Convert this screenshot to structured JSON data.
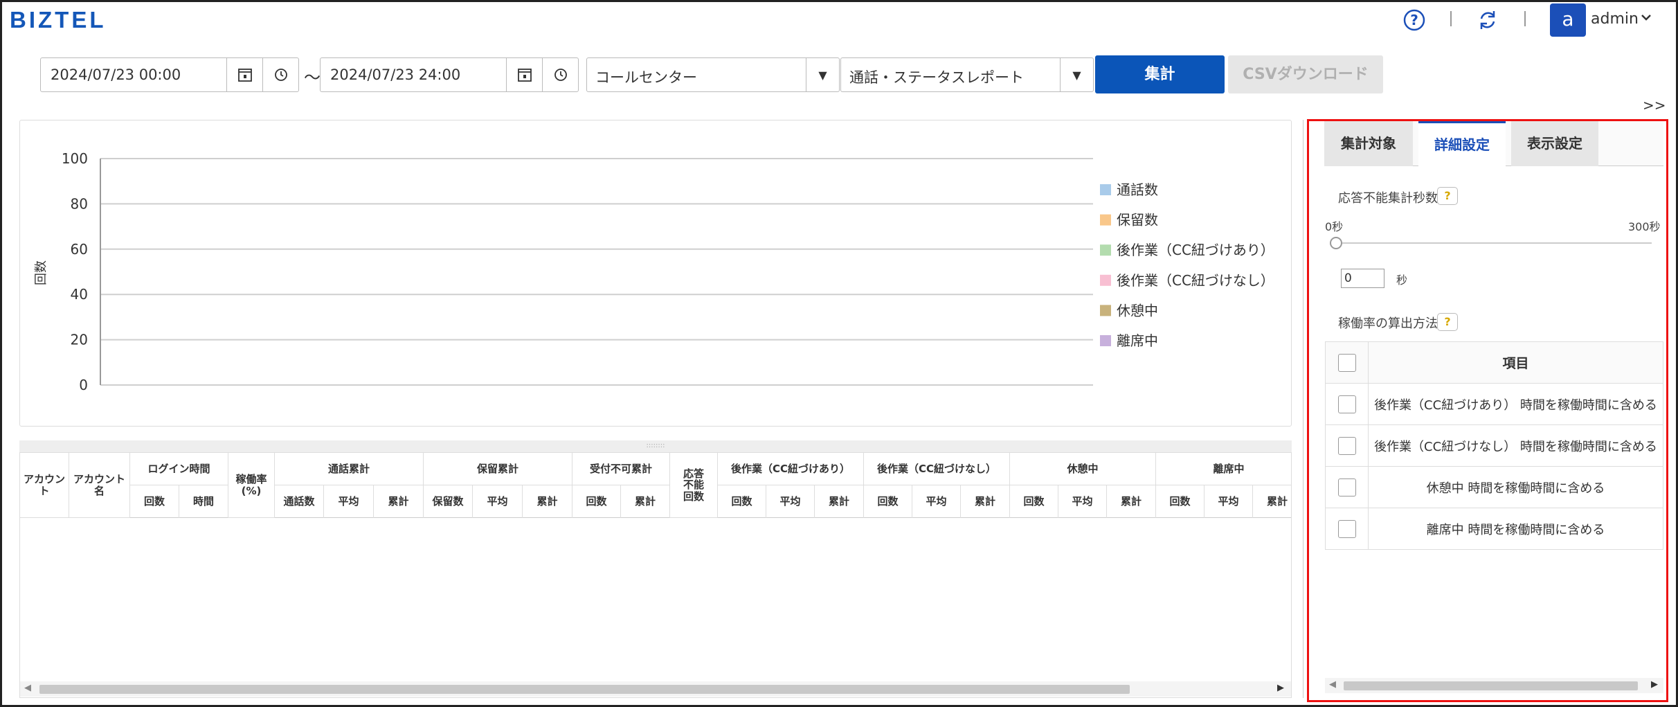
{
  "header": {
    "logo": "BIZTEL",
    "avatar_letter": "a",
    "user_name": "admin",
    "icons": [
      "help-icon",
      "refresh-icon",
      "chevron-down-icon"
    ]
  },
  "toolbar": {
    "start_datetime": "2024/07/23 00:00",
    "end_datetime": "2024/07/23 24:00",
    "range_separator": "～",
    "group_select": "コールセンター",
    "report_select": "通話・ステータスレポート",
    "aggregate_label": "集計",
    "csv_label": "CSVダウンロード",
    "expand_label": ">>"
  },
  "chart_data": {
    "type": "bar",
    "ylabel": "回数",
    "ylim": [
      0,
      100
    ],
    "yticks": [
      "0",
      "20",
      "40",
      "60",
      "80",
      "100"
    ],
    "grid": true,
    "legend_position": "right",
    "series": [
      {
        "name": "通話数",
        "color": "#a9cbea",
        "values": []
      },
      {
        "name": "保留数",
        "color": "#f9c78a",
        "values": []
      },
      {
        "name": "後作業（CC紐づけあり）",
        "color": "#b3dcae",
        "values": []
      },
      {
        "name": "後作業（CC紐づけなし）",
        "color": "#f8bfd2",
        "values": []
      },
      {
        "name": "休憩中",
        "color": "#c8b27c",
        "values": []
      },
      {
        "name": "離席中",
        "color": "#c7b0dc",
        "values": []
      }
    ]
  },
  "table": {
    "splitter_grip": "::::::::",
    "columns": {
      "account": "アカウント",
      "account_name": "アカウント名",
      "login_time": "ログイン時間",
      "utilization": "稼働率(%)",
      "call_total": "通話累計",
      "hold_total": "保留累計",
      "reject_total": "受付不可累計",
      "no_answer": "応答不能回数",
      "wrap_cc": "後作業（CC紐づけあり）",
      "wrap_nocc": "後作業（CC紐づけなし）",
      "break": "休憩中",
      "away": "離席中"
    },
    "sub": {
      "count": "回数",
      "time": "時間",
      "avg": "平均",
      "total": "累計",
      "call_count": "通話数",
      "hold_count": "保留数"
    },
    "rows": []
  },
  "side": {
    "tabs": [
      "集計対象",
      "詳細設定",
      "表示設定"
    ],
    "active_tab": 1,
    "no_answer_label": "応答不能集計秒数",
    "slider_min": "0秒",
    "slider_max": "300秒",
    "slider_value": 0,
    "seconds_value": "0",
    "seconds_unit": "秒",
    "calc_method_label": "稼働率の算出方法",
    "help_glyph": "?",
    "options_header": "項目",
    "options": [
      "後作業（CC紐づけあり） 時間を稼働時間に含める",
      "後作業（CC紐づけなし） 時間を稼働時間に含める",
      "休憩中 時間を稼働時間に含める",
      "離席中 時間を稼働時間に含める"
    ]
  }
}
